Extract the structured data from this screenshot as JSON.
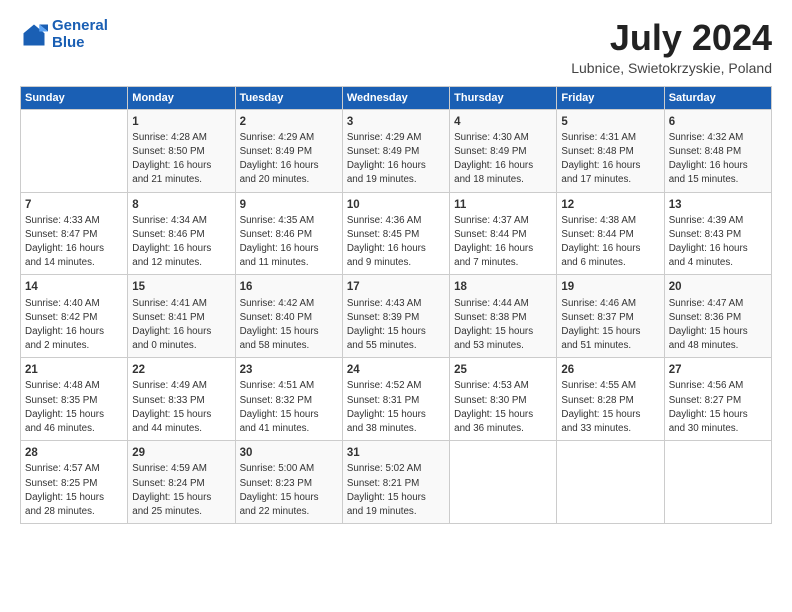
{
  "header": {
    "logo_line1": "General",
    "logo_line2": "Blue",
    "month_year": "July 2024",
    "location": "Lubnice, Swietokrzyskie, Poland"
  },
  "days_of_week": [
    "Sunday",
    "Monday",
    "Tuesday",
    "Wednesday",
    "Thursday",
    "Friday",
    "Saturday"
  ],
  "weeks": [
    [
      {
        "day": "",
        "info": ""
      },
      {
        "day": "1",
        "info": "Sunrise: 4:28 AM\nSunset: 8:50 PM\nDaylight: 16 hours\nand 21 minutes."
      },
      {
        "day": "2",
        "info": "Sunrise: 4:29 AM\nSunset: 8:49 PM\nDaylight: 16 hours\nand 20 minutes."
      },
      {
        "day": "3",
        "info": "Sunrise: 4:29 AM\nSunset: 8:49 PM\nDaylight: 16 hours\nand 19 minutes."
      },
      {
        "day": "4",
        "info": "Sunrise: 4:30 AM\nSunset: 8:49 PM\nDaylight: 16 hours\nand 18 minutes."
      },
      {
        "day": "5",
        "info": "Sunrise: 4:31 AM\nSunset: 8:48 PM\nDaylight: 16 hours\nand 17 minutes."
      },
      {
        "day": "6",
        "info": "Sunrise: 4:32 AM\nSunset: 8:48 PM\nDaylight: 16 hours\nand 15 minutes."
      }
    ],
    [
      {
        "day": "7",
        "info": "Sunrise: 4:33 AM\nSunset: 8:47 PM\nDaylight: 16 hours\nand 14 minutes."
      },
      {
        "day": "8",
        "info": "Sunrise: 4:34 AM\nSunset: 8:46 PM\nDaylight: 16 hours\nand 12 minutes."
      },
      {
        "day": "9",
        "info": "Sunrise: 4:35 AM\nSunset: 8:46 PM\nDaylight: 16 hours\nand 11 minutes."
      },
      {
        "day": "10",
        "info": "Sunrise: 4:36 AM\nSunset: 8:45 PM\nDaylight: 16 hours\nand 9 minutes."
      },
      {
        "day": "11",
        "info": "Sunrise: 4:37 AM\nSunset: 8:44 PM\nDaylight: 16 hours\nand 7 minutes."
      },
      {
        "day": "12",
        "info": "Sunrise: 4:38 AM\nSunset: 8:44 PM\nDaylight: 16 hours\nand 6 minutes."
      },
      {
        "day": "13",
        "info": "Sunrise: 4:39 AM\nSunset: 8:43 PM\nDaylight: 16 hours\nand 4 minutes."
      }
    ],
    [
      {
        "day": "14",
        "info": "Sunrise: 4:40 AM\nSunset: 8:42 PM\nDaylight: 16 hours\nand 2 minutes."
      },
      {
        "day": "15",
        "info": "Sunrise: 4:41 AM\nSunset: 8:41 PM\nDaylight: 16 hours\nand 0 minutes."
      },
      {
        "day": "16",
        "info": "Sunrise: 4:42 AM\nSunset: 8:40 PM\nDaylight: 15 hours\nand 58 minutes."
      },
      {
        "day": "17",
        "info": "Sunrise: 4:43 AM\nSunset: 8:39 PM\nDaylight: 15 hours\nand 55 minutes."
      },
      {
        "day": "18",
        "info": "Sunrise: 4:44 AM\nSunset: 8:38 PM\nDaylight: 15 hours\nand 53 minutes."
      },
      {
        "day": "19",
        "info": "Sunrise: 4:46 AM\nSunset: 8:37 PM\nDaylight: 15 hours\nand 51 minutes."
      },
      {
        "day": "20",
        "info": "Sunrise: 4:47 AM\nSunset: 8:36 PM\nDaylight: 15 hours\nand 48 minutes."
      }
    ],
    [
      {
        "day": "21",
        "info": "Sunrise: 4:48 AM\nSunset: 8:35 PM\nDaylight: 15 hours\nand 46 minutes."
      },
      {
        "day": "22",
        "info": "Sunrise: 4:49 AM\nSunset: 8:33 PM\nDaylight: 15 hours\nand 44 minutes."
      },
      {
        "day": "23",
        "info": "Sunrise: 4:51 AM\nSunset: 8:32 PM\nDaylight: 15 hours\nand 41 minutes."
      },
      {
        "day": "24",
        "info": "Sunrise: 4:52 AM\nSunset: 8:31 PM\nDaylight: 15 hours\nand 38 minutes."
      },
      {
        "day": "25",
        "info": "Sunrise: 4:53 AM\nSunset: 8:30 PM\nDaylight: 15 hours\nand 36 minutes."
      },
      {
        "day": "26",
        "info": "Sunrise: 4:55 AM\nSunset: 8:28 PM\nDaylight: 15 hours\nand 33 minutes."
      },
      {
        "day": "27",
        "info": "Sunrise: 4:56 AM\nSunset: 8:27 PM\nDaylight: 15 hours\nand 30 minutes."
      }
    ],
    [
      {
        "day": "28",
        "info": "Sunrise: 4:57 AM\nSunset: 8:25 PM\nDaylight: 15 hours\nand 28 minutes."
      },
      {
        "day": "29",
        "info": "Sunrise: 4:59 AM\nSunset: 8:24 PM\nDaylight: 15 hours\nand 25 minutes."
      },
      {
        "day": "30",
        "info": "Sunrise: 5:00 AM\nSunset: 8:23 PM\nDaylight: 15 hours\nand 22 minutes."
      },
      {
        "day": "31",
        "info": "Sunrise: 5:02 AM\nSunset: 8:21 PM\nDaylight: 15 hours\nand 19 minutes."
      },
      {
        "day": "",
        "info": ""
      },
      {
        "day": "",
        "info": ""
      },
      {
        "day": "",
        "info": ""
      }
    ]
  ]
}
